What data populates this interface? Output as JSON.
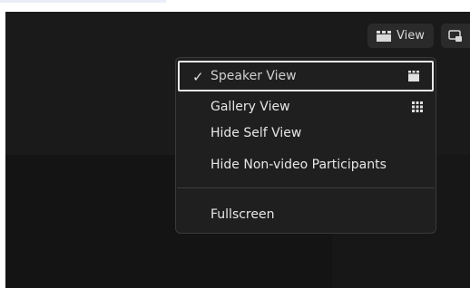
{
  "toolbar": {
    "view_label": "View",
    "view_icon": "speaker-view-icon",
    "extra_icon": "screen-overlay-icon"
  },
  "view_menu": {
    "items": [
      {
        "label": "Speaker View",
        "checked": true,
        "icon": "speaker-view-icon"
      },
      {
        "label": "Gallery View",
        "checked": false,
        "icon": "gallery-grid-icon"
      },
      {
        "label": "Hide Self View",
        "checked": false
      },
      {
        "label": "Hide Non-video Participants",
        "checked": false
      },
      {
        "label": "Fullscreen",
        "checked": false
      }
    ],
    "check_glyph": "✓"
  },
  "colors": {
    "stage_bg": "#1a1a1a",
    "menu_bg": "#1f1f1f",
    "menu_text": "#e7e7e7",
    "selection_border": "#e8e8e8"
  }
}
